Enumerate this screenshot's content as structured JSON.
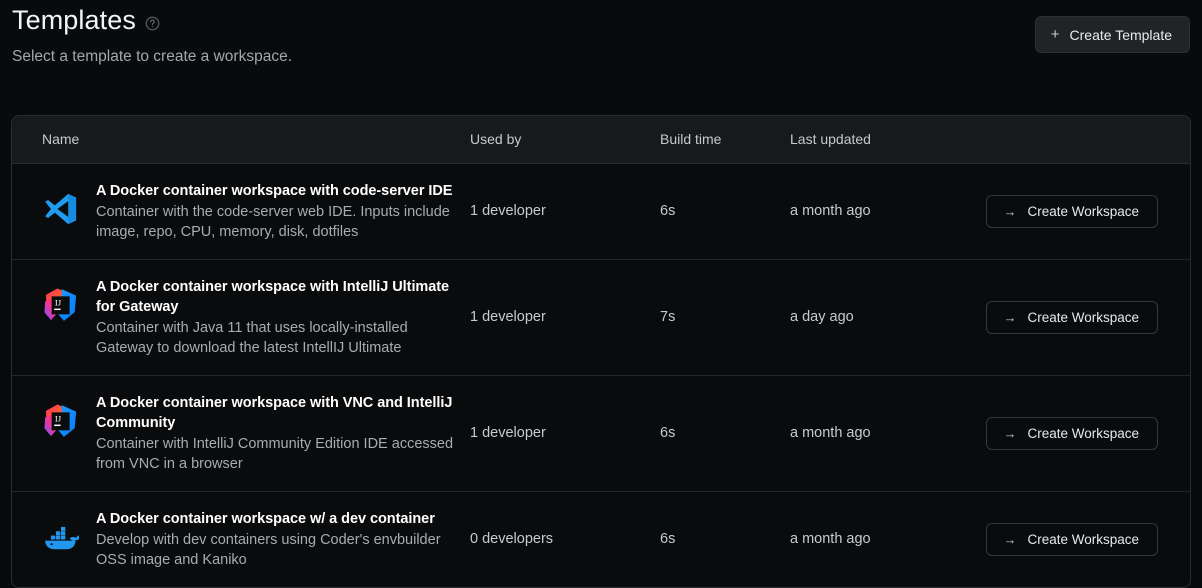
{
  "header": {
    "title": "Templates",
    "help_icon": "help-circle-icon",
    "subtitle": "Select a template to create a workspace.",
    "create_template_label": "Create Template",
    "create_template_icon": "plus-icon"
  },
  "table": {
    "columns": [
      "Name",
      "Used by",
      "Build time",
      "Last updated",
      ""
    ],
    "rows": [
      {
        "icon": "vscode-icon",
        "name": "A Docker container workspace with code-server IDE",
        "description": "Container with the code-server web IDE. Inputs include image, repo, CPU, memory, disk, dotfiles",
        "used_by": "1 developer",
        "build_time": "6s",
        "last_updated": "a month ago",
        "action_label": "Create Workspace",
        "action_icon": "arrow-right-icon"
      },
      {
        "icon": "intellij-icon",
        "name": "A Docker container workspace with IntelliJ Ultimate for Gateway",
        "description": "Container with Java 11 that uses locally-installed Gateway to download the latest IntellIJ Ultimate",
        "used_by": "1 developer",
        "build_time": "7s",
        "last_updated": "a day ago",
        "action_label": "Create Workspace",
        "action_icon": "arrow-right-icon"
      },
      {
        "icon": "intellij-icon",
        "name": "A Docker container workspace with VNC and IntelliJ Community",
        "description": "Container with IntelliJ Community Edition IDE accessed from VNC in a browser",
        "used_by": "1 developer",
        "build_time": "6s",
        "last_updated": "a month ago",
        "action_label": "Create Workspace",
        "action_icon": "arrow-right-icon"
      },
      {
        "icon": "docker-icon",
        "name": "A Docker container workspace w/ a dev container",
        "description": "Develop with dev containers using Coder's envbuilder OSS image and Kaniko",
        "used_by": "0 developers",
        "build_time": "6s",
        "last_updated": "a month ago",
        "action_label": "Create Workspace",
        "action_icon": "arrow-right-icon"
      }
    ]
  },
  "colors": {
    "background": "#090a0b",
    "table_header_bg": "#18191b",
    "border": "#2a2d30",
    "text_primary": "#ffffff",
    "text_secondary": "#a8acb1",
    "button_bg": "#212426"
  }
}
